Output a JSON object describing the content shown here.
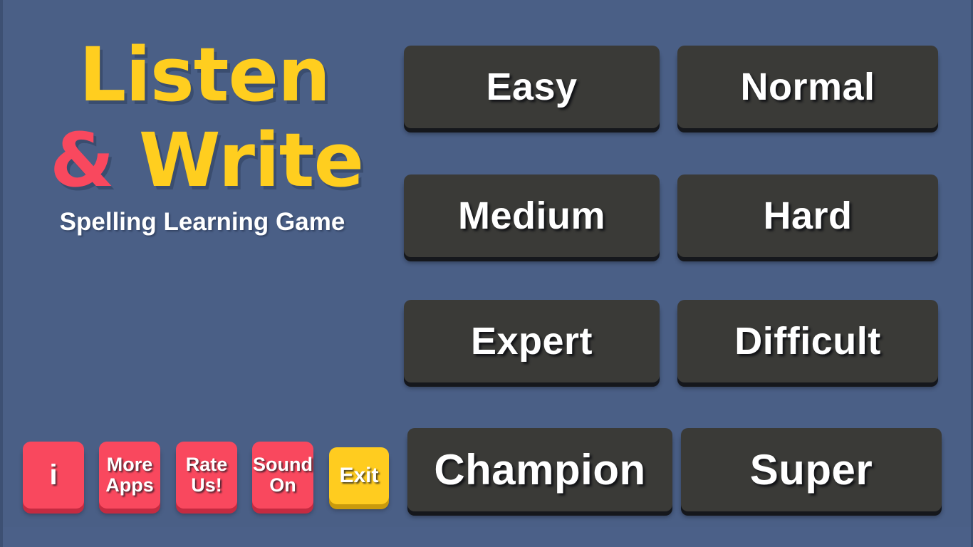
{
  "app": {
    "title_line1": "Listen",
    "title_ampersand": "&",
    "title_line2": "Write",
    "subtitle": "Spelling Learning Game",
    "background_color": "#4a5f86",
    "title_color": "#FFCE1F",
    "ampersand_color": "#F9485E",
    "button_color": "#3a3a37",
    "util_color": "#F9485E",
    "exit_color": "#FFCC1F"
  },
  "difficulty_buttons": [
    {
      "label": "Easy"
    },
    {
      "label": "Normal"
    },
    {
      "label": "Medium"
    },
    {
      "label": "Hard"
    },
    {
      "label": "Expert"
    },
    {
      "label": "Difficult"
    },
    {
      "label": "Champion"
    },
    {
      "label": "Super"
    }
  ],
  "utility_buttons": [
    {
      "label": "i"
    },
    {
      "label": "More\nApps"
    },
    {
      "label": "Rate\nUs!"
    },
    {
      "label": "Sound\nOn"
    },
    {
      "label": "Exit"
    }
  ]
}
